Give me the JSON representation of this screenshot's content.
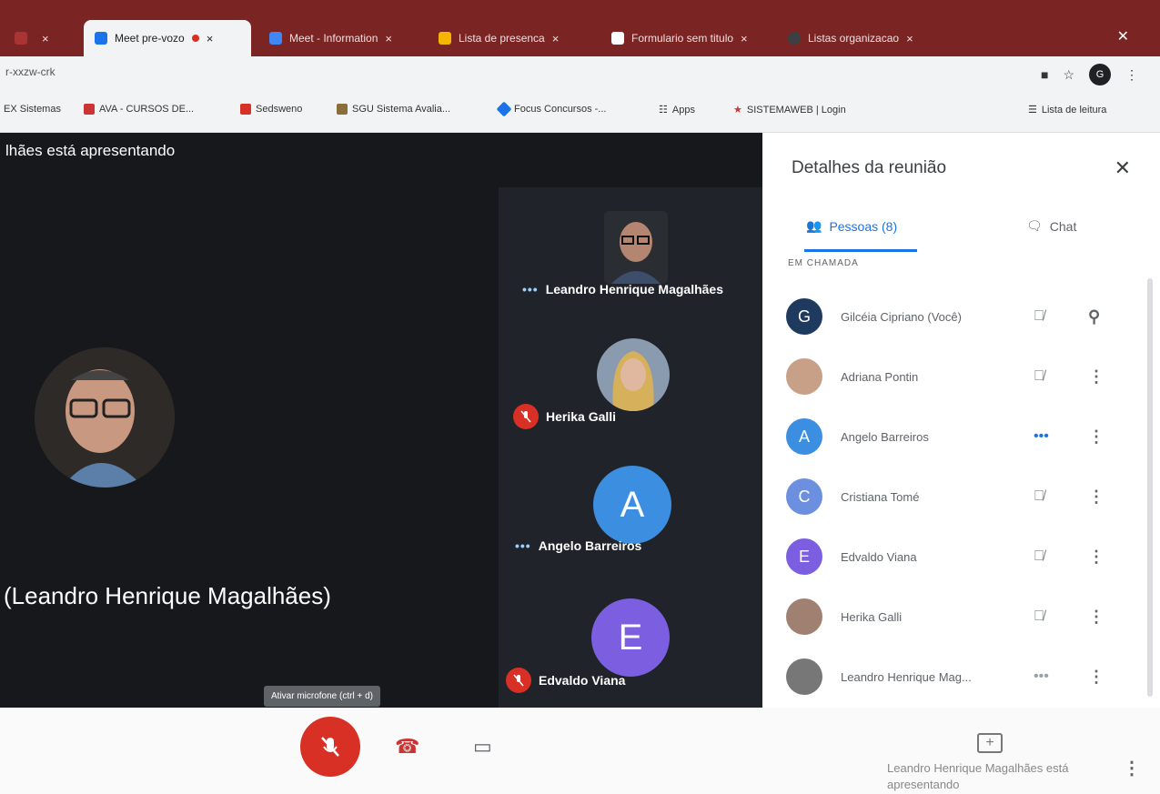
{
  "browser": {
    "tabs": [
      {
        "label": "",
        "color": "#c44"
      },
      {
        "label": "Meet pre-vozo",
        "color": "#1a73e8",
        "active": true
      },
      {
        "label": "Meet - Information",
        "color": "#4285f4"
      },
      {
        "label": "Lista de presenca",
        "color": "#f4b400"
      },
      {
        "label": "Formulario sem titulo",
        "color": "#ffffff"
      },
      {
        "label": "Listas organizacao",
        "color": "#3c4043"
      }
    ],
    "url": "r-xxzw-crk",
    "profile_initial": "G",
    "bookmarks": [
      {
        "label": "EX Sistemas",
        "color": "#888"
      },
      {
        "label": "AVA - CURSOS DE...",
        "color": "#c33"
      },
      {
        "label": "Sedsweno",
        "color": "#d93025"
      },
      {
        "label": "SGU Sistema Avalia...",
        "color": "#8a6d3b"
      },
      {
        "label": "Focus Concursos -...",
        "color": "#1a73e8"
      },
      {
        "label": "Apps",
        "color": "#5f6368"
      },
      {
        "label": "SISTEMAWEB | Login",
        "color": "#c33"
      },
      {
        "label": "Lista de leitura",
        "color": "#5f6368"
      }
    ]
  },
  "stage": {
    "presenting_text": "lhães está apresentando",
    "main_name": "(Leandro Henrique Magalhães)",
    "tiles": [
      {
        "name": "Leandro Henrique Magalhães",
        "status": "dots"
      },
      {
        "name": "Herika Galli",
        "status": "muted"
      },
      {
        "name": "Angelo Barreiros",
        "status": "dots",
        "initial": "A",
        "color": "#3b8ee0"
      },
      {
        "name": "Edvaldo Viana",
        "status": "muted",
        "initial": "E",
        "color": "#7b5fe0"
      }
    ]
  },
  "controls": {
    "tooltip": "Ativar microfone (ctrl + d)",
    "presenting_note": "Leandro Henrique Magalhães está apresentando"
  },
  "panel": {
    "title": "Detalhes da reunião",
    "people_tab": "Pessoas (8)",
    "chat_tab": "Chat",
    "section_label": "EM CHAMADA",
    "people": [
      {
        "name": "Gilcéia Cipriano (Você)",
        "initial": "G",
        "color": "#1e3a5f",
        "status": "muted",
        "action": "pin"
      },
      {
        "name": "Adriana Pontin",
        "initial": "",
        "color": "#c8a088",
        "status": "muted",
        "action": "more"
      },
      {
        "name": "Angelo Barreiros",
        "initial": "A",
        "color": "#3b8ee0",
        "status": "dots",
        "action": "more"
      },
      {
        "name": "Cristiana Tomé",
        "initial": "C",
        "color": "#6d8fe0",
        "status": "muted",
        "action": "more"
      },
      {
        "name": "Edvaldo Viana",
        "initial": "E",
        "color": "#7b5fe0",
        "status": "muted",
        "action": "more"
      },
      {
        "name": "Herika Galli",
        "initial": "",
        "color": "#a08070",
        "status": "muted",
        "action": "more"
      },
      {
        "name": "Leandro Henrique Mag...",
        "initial": "",
        "color": "#777",
        "status": "dots",
        "action": "more"
      }
    ]
  }
}
